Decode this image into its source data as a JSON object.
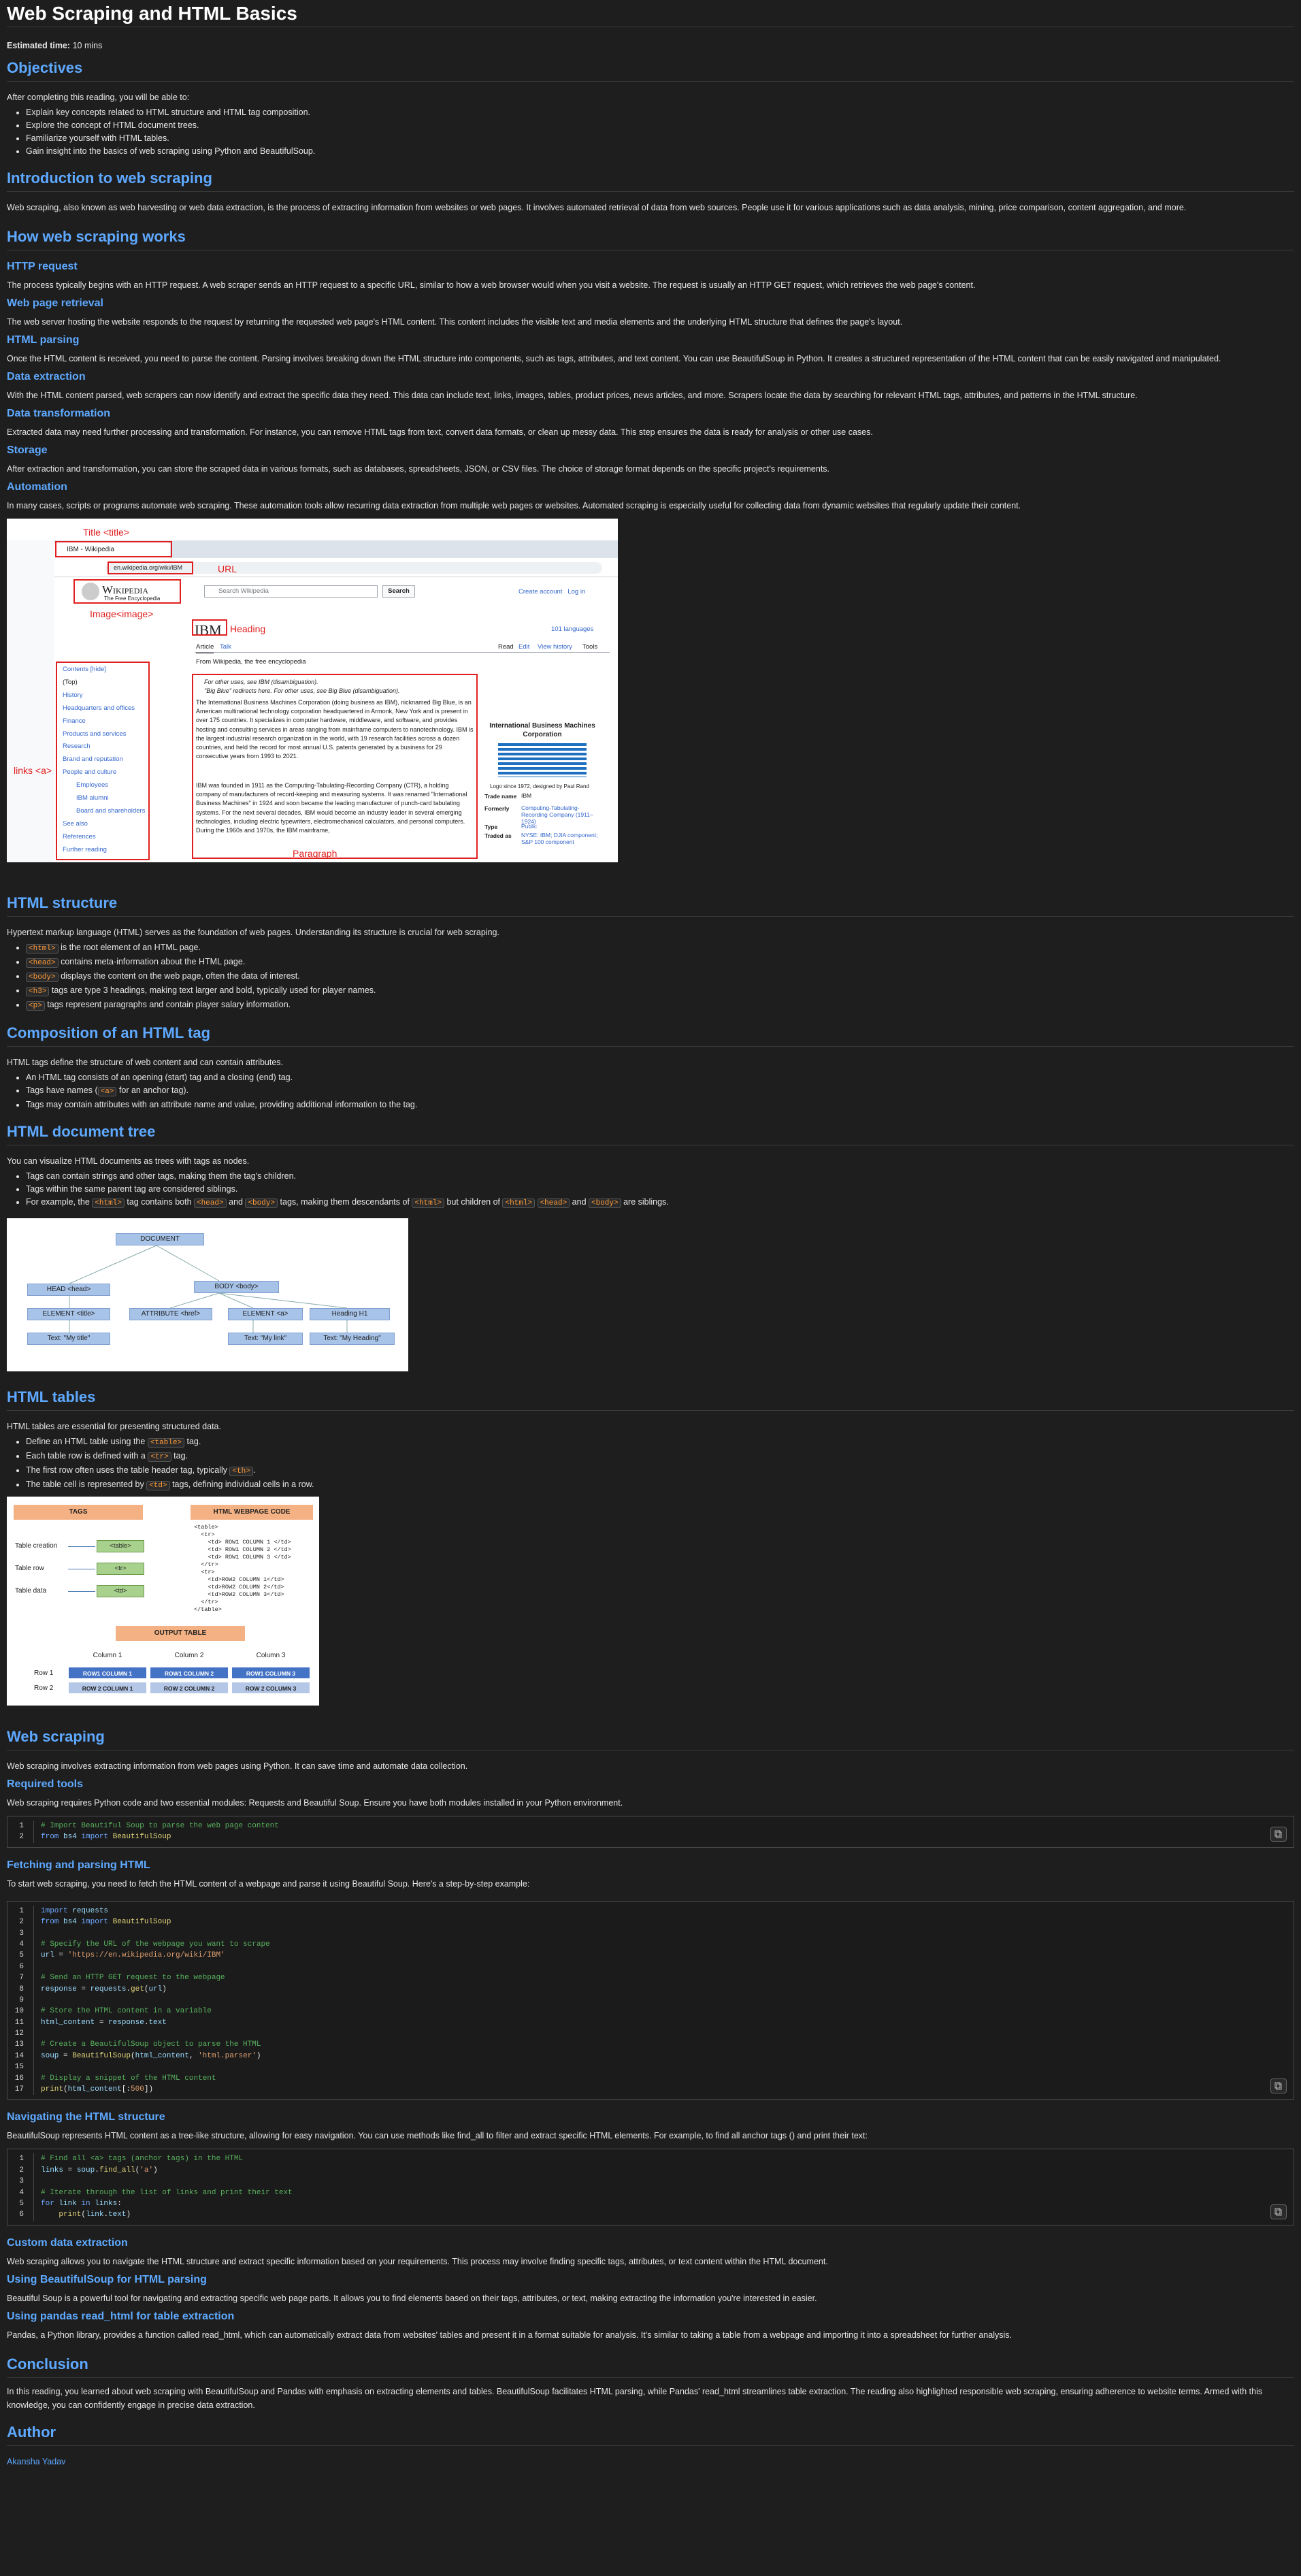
{
  "title": "Web Scraping and HTML Basics",
  "est_label": "Estimated time:",
  "est_value": "10 mins",
  "objectives": {
    "heading": "Objectives",
    "intro": "After completing this reading, you will be able to:",
    "items": [
      "Explain key concepts related to HTML structure and HTML tag composition.",
      "Explore the concept of HTML document trees.",
      "Familiarize yourself with HTML tables.",
      "Gain insight into the basics of web scraping using Python and BeautifulSoup."
    ]
  },
  "intro": {
    "heading": "Introduction to web scraping",
    "text": "Web scraping, also known as web harvesting or web data extraction, is the process of extracting information from websites or web pages. It involves automated retrieval of data from web sources. People use it for various applications such as data analysis, mining, price comparison, content aggregation, and more."
  },
  "how": {
    "heading": "How web scraping works",
    "sections": [
      {
        "h": "HTTP request",
        "t": "The process typically begins with an HTTP request. A web scraper sends an HTTP request to a specific URL, similar to how a web browser would when you visit a website. The request is usually an HTTP GET request, which retrieves the web page's content."
      },
      {
        "h": "Web page retrieval",
        "t": "The web server hosting the website responds to the request by returning the requested web page's HTML content. This content includes the visible text and media elements and the underlying HTML structure that defines the page's layout."
      },
      {
        "h": "HTML parsing",
        "t": "Once the HTML content is received, you need to parse the content. Parsing involves breaking down the HTML structure into components, such as tags, attributes, and text content. You can use BeautifulSoup in Python. It creates a structured representation of the HTML content that can be easily navigated and manipulated."
      },
      {
        "h": "Data extraction",
        "t": "With the HTML content parsed, web scrapers can now identify and extract the specific data they need. This data can include text, links, images, tables, product prices, news articles, and more. Scrapers locate the data by searching for relevant HTML tags, attributes, and patterns in the HTML structure."
      },
      {
        "h": "Data transformation",
        "t": "Extracted data may need further processing and transformation. For instance, you can remove HTML tags from text, convert data formats, or clean up messy data. This step ensures the data is ready for analysis or other use cases."
      },
      {
        "h": "Storage",
        "t": "After extraction and transformation, you can store the scraped data in various formats, such as databases, spreadsheets, JSON, or CSV files. The choice of storage format depends on the specific project's requirements."
      },
      {
        "h": "Automation",
        "t": "In many cases, scripts or programs automate web scraping. These automation tools allow recurring data extraction from multiple web pages or websites. Automated scraping is especially useful for collecting data from dynamic websites that regularly update their content."
      }
    ]
  },
  "wiki": {
    "tab": "IBM - Wikipedia",
    "url": "en.wikipedia.org/wiki/IBM",
    "brand": "Wikipedia",
    "tagline": "The Free Encyclopedia",
    "search": "Search Wikipedia",
    "search_btn": "Search",
    "account": "Create account   Log in",
    "heading": "IBM",
    "languages": "101 languages",
    "tabs": [
      "Article",
      "Talk"
    ],
    "actions": [
      "Read",
      "Edit",
      "View history",
      "Tools"
    ],
    "from": "From Wikipedia, the free encyclopedia",
    "toc": [
      "Contents [hide]",
      "(Top)",
      "History",
      "Headquarters and offices",
      "Finance",
      "Products and services",
      "Research",
      "Brand and reputation",
      "People and culture",
      "Employees",
      "IBM alumni",
      "Board and shareholders",
      "See also",
      "References",
      "Further reading"
    ],
    "hat1": "For other uses, see IBM (disambiguation).",
    "hat2": "\"Big Blue\" redirects here. For other uses, see Big Blue (disambiguation).",
    "para1": "The International Business Machines Corporation (doing business as IBM), nicknamed Big Blue, is an American multinational technology corporation headquartered in Armonk, New York and is present in over 175 countries. It specializes in computer hardware, middleware, and software, and provides hosting and consulting services in areas ranging from mainframe computers to nanotechnology. IBM is the largest industrial research organization in the world, with 19 research facilities across a dozen countries, and held the record for most annual U.S. patents generated by a business for 29 consecutive years from 1993 to 2021.",
    "para2": "IBM was founded in 1911 as the Computing-Tabulating-Recording Company (CTR), a holding company of manufacturers of record-keeping and measuring systems. It was renamed \"International Business Machines\" in 1924 and soon became the leading manufacturer of punch-card tabulating systems. For the next several decades, IBM would become an industry leader in several emerging technologies, including electric typewriters, electromechanical calculators, and personal computers. During the 1960s and 1970s, the IBM mainframe,",
    "infobox_title": "International Business Machines Corporation",
    "logo_caption": "Logo since 1972, designed by Paul Rand",
    "info_rows": [
      [
        "Trade name",
        "IBM"
      ],
      [
        "Formerly",
        "Computing-Tabulating-Recording Company (1911–1924)"
      ],
      [
        "Type",
        "Public"
      ],
      [
        "Traded as",
        "NYSE: IBM; DJIA component; S&P 100 component"
      ]
    ],
    "labels": {
      "title": "Title <title>",
      "url": "URL",
      "image": "Image<image>",
      "heading": "Heading",
      "links": "links <a>",
      "paragraph": "Paragraph"
    }
  },
  "structure": {
    "heading": "HTML structure",
    "intro": "Hypertext markup language (HTML) serves as the foundation of web pages. Understanding its structure is crucial for web scraping.",
    "items": [
      {
        "code": "<html>",
        "text": " is the root element of an HTML page."
      },
      {
        "code": "<head>",
        "text": " contains meta-information about the HTML page."
      },
      {
        "code": "<body>",
        "text": " displays the content on the web page, often the data of interest."
      },
      {
        "code": "<h3>",
        "text": " tags are type 3 headings, making text larger and bold, typically used for player names."
      },
      {
        "code": "<p>",
        "text": " tags represent paragraphs and contain player salary information."
      }
    ]
  },
  "composition": {
    "heading": "Composition of an HTML tag",
    "intro": "HTML tags define the structure of web content and can contain attributes.",
    "items": [
      "An HTML tag consists of an opening (start) tag and a closing (end) tag.",
      "Tags have names (",
      ")",
      "Tags may contain attributes with an attribute name and value, providing additional information to the tag."
    ],
    "a_code": "<a>",
    "a_suffix": " for an anchor tag)."
  },
  "tree": {
    "heading": "HTML document tree",
    "intro": "You can visualize HTML documents as trees with tags as nodes.",
    "items": [
      "Tags can contain strings and other tags, making them the tag's children.",
      "Tags within the same parent tag are considered siblings."
    ],
    "ex": {
      "p1": "For example, the ",
      "c1": "<html>",
      "p2": " tag contains both ",
      "c2": "<head>",
      "p3": " and ",
      "c3": "<body>",
      "p4": " tags, making them descendants of ",
      "c4": "<html>",
      "p5": " but children of ",
      "c5": "<html>",
      "c6": "<head>",
      "p6": " and ",
      "c7": "<body>",
      "p7": " are siblings."
    },
    "nodes": {
      "doc": "DOCUMENT",
      "head": "HEAD <head>",
      "body": "BODY <body>",
      "title": "ELEMENT <title>",
      "attr": "ATTRIBUTE <href>",
      "a": "ELEMENT <a>",
      "h1": "Heading H1",
      "t1": "Text: \"My title\"",
      "t2": "Text: \"My link\"",
      "t3": "Text: \"My Heading\""
    }
  },
  "tables": {
    "heading": "HTML tables",
    "intro": "HTML tables are essential for presenting structured data.",
    "items": [
      {
        "a": "Define an HTML table using the ",
        "c": "<table>",
        "b": " tag."
      },
      {
        "a": "Each table row is defined with a ",
        "c": "<tr>",
        "b": " tag."
      },
      {
        "a": "The first row often uses the table header tag, typically ",
        "c": "<th>",
        "b": "."
      },
      {
        "a": "The table cell is represented by ",
        "c": "<td>",
        "b": " tags, defining individual cells in a row."
      }
    ],
    "fig": {
      "tags_title": "TAGS",
      "code_title": "HTML WEBPAGE CODE",
      "rows": [
        [
          "Table creation",
          "<table>"
        ],
        [
          "Table row",
          "<tr>"
        ],
        [
          "Table data",
          "<td>"
        ]
      ],
      "code": [
        "<table>",
        "  <tr>",
        "    <td> ROW1 COLUMN 1 </td>",
        "    <td> ROW1 COLUMN 2 </td>",
        "    <td> ROW1 COLUMN 3 </td>",
        "  </tr>",
        "  <tr>",
        "    <td>ROW2 COLUMN 1</td>",
        "    <td>ROW2 COLUMN 2</td>",
        "    <td>ROW2 COLUMN 3</td>",
        "  </tr>",
        "</table>"
      ],
      "out_title": "OUTPUT TABLE",
      "cols": [
        "Column 1",
        "Column 2",
        "Column 3"
      ],
      "r1": "Row 1",
      "r2": "Row 2",
      "r1c": [
        "ROW1 COLUMN 1",
        "ROW1 COLUMN 2",
        "ROW1 COLUMN 3"
      ],
      "r2c": [
        "ROW 2 COLUMN 1",
        "ROW 2 COLUMN 2",
        "ROW 2 COLUMN 3"
      ]
    }
  },
  "scraping": {
    "heading": "Web scraping",
    "intro": "Web scraping involves extracting information from web pages using Python. It can save time and automate data collection.",
    "tools_h": "Required tools",
    "tools_t": "Web scraping requires Python code and two essential modules: Requests and Beautiful Soup. Ensure you have both modules installed in your Python environment.",
    "fetch_h": "Fetching and parsing HTML",
    "fetch_t": "To start web scraping, you need to fetch the HTML content of a webpage and parse it using Beautiful Soup. Here's a step-by-step example:",
    "nav_h": "Navigating the HTML structure",
    "nav_t": "BeautifulSoup represents HTML content as a tree-like structure, allowing for easy navigation. You can use methods like find_all to filter and extract specific HTML elements. For example, to find all anchor tags () and print their text:",
    "custom_h": "Custom data extraction",
    "custom_t": "Web scraping allows you to navigate the HTML structure and extract specific information based on your requirements. This process may involve finding specific tags, attributes, or text content within the HTML document.",
    "bs_h": "Using BeautifulSoup for HTML parsing",
    "bs_t": "Beautiful Soup is a powerful tool for navigating and extracting specific web page parts. It allows you to find elements based on their tags, attributes, or text, making extracting the information you're interested in easier.",
    "pd_h": "Using pandas read_html for table extraction",
    "pd_t": "Pandas, a Python library, provides a function called read_html, which can automatically extract data from websites' tables and present it in a format suitable for analysis. It’s similar to taking a table from a webpage and importing it into a spreadsheet for further analysis."
  },
  "code1": [
    [
      "cmt",
      "# Import Beautiful Soup to parse the web page content"
    ],
    [
      "mix",
      [
        [
          "kw",
          "from "
        ],
        [
          "var",
          "bs4"
        ],
        [
          "kw",
          " import "
        ],
        [
          "fn",
          "BeautifulSoup"
        ]
      ]
    ]
  ],
  "code2": [
    [
      "mix",
      [
        [
          "kw",
          "import "
        ],
        [
          "var",
          "requests"
        ]
      ]
    ],
    [
      "mix",
      [
        [
          "kw",
          "from "
        ],
        [
          "var",
          "bs4"
        ],
        [
          "kw",
          " import "
        ],
        [
          "fn",
          "BeautifulSoup"
        ]
      ]
    ],
    [
      "plain",
      ""
    ],
    [
      "cmt",
      "# Specify the URL of the webpage you want to scrape"
    ],
    [
      "mix",
      [
        [
          "var",
          "url"
        ],
        [
          "plain",
          " = "
        ],
        [
          "str",
          "'https://en.wikipedia.org/wiki/IBM'"
        ]
      ]
    ],
    [
      "plain",
      ""
    ],
    [
      "cmt",
      "# Send an HTTP GET request to the webpage"
    ],
    [
      "mix",
      [
        [
          "var",
          "response"
        ],
        [
          "plain",
          " = "
        ],
        [
          "var",
          "requests"
        ],
        [
          "plain",
          "."
        ],
        [
          "fn",
          "get"
        ],
        [
          "plain",
          "("
        ],
        [
          "var",
          "url"
        ],
        [
          "plain",
          ")"
        ]
      ]
    ],
    [
      "plain",
      ""
    ],
    [
      "cmt",
      "# Store the HTML content in a variable"
    ],
    [
      "mix",
      [
        [
          "var",
          "html_content"
        ],
        [
          "plain",
          " = "
        ],
        [
          "var",
          "response"
        ],
        [
          "plain",
          "."
        ],
        [
          "var",
          "text"
        ]
      ]
    ],
    [
      "plain",
      ""
    ],
    [
      "cmt",
      "# Create a BeautifulSoup object to parse the HTML"
    ],
    [
      "mix",
      [
        [
          "var",
          "soup"
        ],
        [
          "plain",
          " = "
        ],
        [
          "fn",
          "BeautifulSoup"
        ],
        [
          "plain",
          "("
        ],
        [
          "var",
          "html_content"
        ],
        [
          "plain",
          ", "
        ],
        [
          "str",
          "'html.parser'"
        ],
        [
          "plain",
          ")"
        ]
      ]
    ],
    [
      "plain",
      ""
    ],
    [
      "cmt",
      "# Display a snippet of the HTML content"
    ],
    [
      "mix",
      [
        [
          "fn",
          "print"
        ],
        [
          "plain",
          "("
        ],
        [
          "var",
          "html_content"
        ],
        [
          "plain",
          "[:"
        ],
        [
          "str",
          "500"
        ],
        [
          "plain",
          "])"
        ]
      ]
    ]
  ],
  "code3": [
    [
      "cmt",
      "# Find all <a> tags (anchor tags) in the HTML"
    ],
    [
      "mix",
      [
        [
          "var",
          "links"
        ],
        [
          "plain",
          " = "
        ],
        [
          "var",
          "soup"
        ],
        [
          "plain",
          "."
        ],
        [
          "fn",
          "find_all"
        ],
        [
          "plain",
          "("
        ],
        [
          "str",
          "'a'"
        ],
        [
          "plain",
          ")"
        ]
      ]
    ],
    [
      "plain",
      ""
    ],
    [
      "cmt",
      "# Iterate through the list of links and print their text"
    ],
    [
      "mix",
      [
        [
          "kw",
          "for "
        ],
        [
          "var",
          "link"
        ],
        [
          "kw",
          " in "
        ],
        [
          "var",
          "links"
        ],
        [
          "plain",
          ":"
        ]
      ]
    ],
    [
      "mix",
      [
        [
          "plain",
          "    "
        ],
        [
          "fn",
          "print"
        ],
        [
          "plain",
          "("
        ],
        [
          "var",
          "link"
        ],
        [
          "plain",
          "."
        ],
        [
          "var",
          "text"
        ],
        [
          "plain",
          ")"
        ]
      ]
    ]
  ],
  "conclusion": {
    "heading": "Conclusion",
    "text": "In this reading, you learned about web scraping with BeautifulSoup and Pandas with emphasis on extracting elements and tables. BeautifulSoup facilitates HTML parsing, while Pandas' read_html streamlines table extraction. The reading also highlighted responsible web scraping, ensuring adherence to website terms. Armed with this knowledge, you can confidently engage in precise data extraction."
  },
  "author": {
    "heading": "Author",
    "name": "Akansha Yadav"
  }
}
